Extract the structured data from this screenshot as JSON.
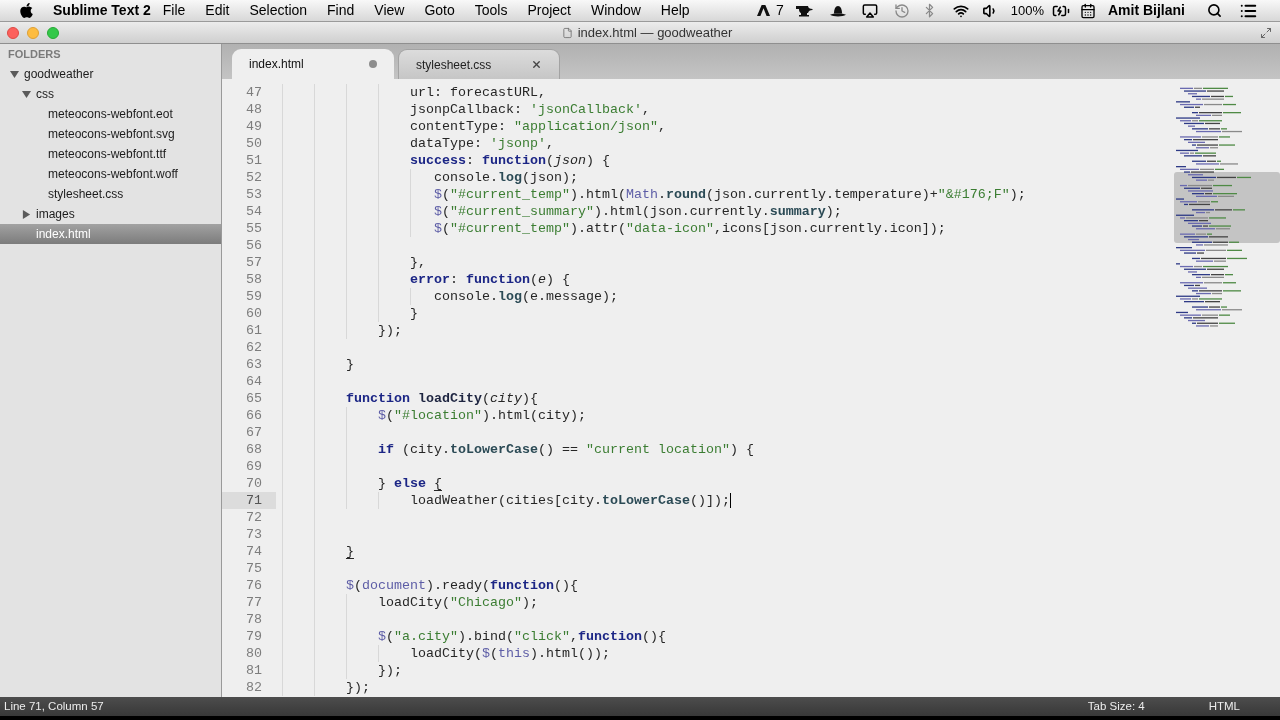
{
  "menu_bar": {
    "app_name": "Sublime Text 2",
    "menus": [
      "File",
      "Edit",
      "Selection",
      "Find",
      "View",
      "Goto",
      "Tools",
      "Project",
      "Window",
      "Help"
    ],
    "update_count": "7",
    "battery": "100%",
    "user": "Amit Bijlani"
  },
  "title_bar": {
    "title": "index.html — goodweather"
  },
  "sidebar": {
    "header": "FOLDERS",
    "items": [
      {
        "label": "goodweather",
        "kind": "folder",
        "expanded": true,
        "selected": false,
        "children": [
          {
            "label": "css",
            "kind": "folder",
            "expanded": true,
            "selected": false,
            "children": [
              {
                "label": "meteocons-webfont.eot",
                "kind": "file",
                "selected": false
              },
              {
                "label": "meteocons-webfont.svg",
                "kind": "file",
                "selected": false
              },
              {
                "label": "meteocons-webfont.ttf",
                "kind": "file",
                "selected": false
              },
              {
                "label": "meteocons-webfont.woff",
                "kind": "file",
                "selected": false
              },
              {
                "label": "stylesheet.css",
                "kind": "file",
                "selected": false
              }
            ]
          },
          {
            "label": "images",
            "kind": "folder",
            "expanded": false,
            "selected": false
          },
          {
            "label": "index.html",
            "kind": "file",
            "selected": true
          }
        ]
      }
    ]
  },
  "tabs": [
    {
      "label": "index.html",
      "selected": true,
      "modified": true
    },
    {
      "label": "stylesheet.css",
      "selected": false,
      "modified": false
    }
  ],
  "editor": {
    "lines": [
      {
        "number": "47",
        "current": false,
        "tokens": [
          {
            "text": "                url: forecastURL,",
            "kind": "plain"
          }
        ]
      },
      {
        "number": "48",
        "current": false,
        "tokens": [
          {
            "text": "                jsonpCallback: ",
            "kind": "plain"
          },
          {
            "text": "'jsonCallback'",
            "kind": "string"
          },
          {
            "text": ",",
            "kind": "plain"
          }
        ]
      },
      {
        "number": "49",
        "current": false,
        "tokens": [
          {
            "text": "                contentType: ",
            "kind": "plain"
          },
          {
            "text": "\"application/json\"",
            "kind": "string"
          },
          {
            "text": ",",
            "kind": "plain"
          }
        ]
      },
      {
        "number": "50",
        "current": false,
        "tokens": [
          {
            "text": "                dataType: ",
            "kind": "plain"
          },
          {
            "text": "'jsonp'",
            "kind": "string"
          },
          {
            "text": ",",
            "kind": "plain"
          }
        ]
      },
      {
        "number": "51",
        "current": false,
        "tokens": [
          {
            "text": "                success",
            "kind": "property"
          },
          {
            "text": ": ",
            "kind": "plain"
          },
          {
            "text": "function",
            "kind": "keyword"
          },
          {
            "text": "(",
            "kind": "plain"
          },
          {
            "text": "json",
            "kind": "param"
          },
          {
            "text": ") {",
            "kind": "plain"
          }
        ]
      },
      {
        "number": "52",
        "current": false,
        "tokens": [
          {
            "text": "                   console.",
            "kind": "plain"
          },
          {
            "text": "log",
            "kind": "method"
          },
          {
            "text": "(json);",
            "kind": "plain"
          }
        ]
      },
      {
        "number": "53",
        "current": false,
        "tokens": [
          {
            "text": "                   $",
            "kind": "builtin"
          },
          {
            "text": "(",
            "kind": "plain"
          },
          {
            "text": "\"#current_temp\"",
            "kind": "string"
          },
          {
            "text": ").html(",
            "kind": "plain"
          },
          {
            "text": "Math",
            "kind": "builtin"
          },
          {
            "text": ".",
            "kind": "plain"
          },
          {
            "text": "round",
            "kind": "method"
          },
          {
            "text": "(json.currently.temperature)+",
            "kind": "plain"
          },
          {
            "text": "\"&#176;F\"",
            "kind": "string"
          },
          {
            "text": ");",
            "kind": "plain"
          }
        ]
      },
      {
        "number": "54",
        "current": false,
        "tokens": [
          {
            "text": "                   $",
            "kind": "builtin"
          },
          {
            "text": "(",
            "kind": "plain"
          },
          {
            "text": "\"#current_summary\"",
            "kind": "string"
          },
          {
            "text": ").html(json.currently.",
            "kind": "plain"
          },
          {
            "text": "summary",
            "kind": "method"
          },
          {
            "text": ");",
            "kind": "plain"
          }
        ]
      },
      {
        "number": "55",
        "current": false,
        "tokens": [
          {
            "text": "                   $",
            "kind": "builtin"
          },
          {
            "text": "(",
            "kind": "plain"
          },
          {
            "text": "\"#current_temp\"",
            "kind": "string"
          },
          {
            "text": ").attr(",
            "kind": "plain"
          },
          {
            "text": "\"data-icon\"",
            "kind": "string"
          },
          {
            "text": ",icons[json.currently.icon]);",
            "kind": "plain"
          }
        ]
      },
      {
        "number": "56",
        "current": false
      },
      {
        "number": "57",
        "current": false,
        "tokens": [
          {
            "text": "                },",
            "kind": "plain"
          }
        ]
      },
      {
        "number": "58",
        "current": false,
        "tokens": [
          {
            "text": "                error",
            "kind": "property"
          },
          {
            "text": ": ",
            "kind": "plain"
          },
          {
            "text": "function",
            "kind": "keyword"
          },
          {
            "text": "(",
            "kind": "plain"
          },
          {
            "text": "e",
            "kind": "param"
          },
          {
            "text": ") {",
            "kind": "plain"
          }
        ]
      },
      {
        "number": "59",
        "current": false,
        "tokens": [
          {
            "text": "                   console.",
            "kind": "plain"
          },
          {
            "text": "log",
            "kind": "method"
          },
          {
            "text": "(e.message);",
            "kind": "plain"
          }
        ]
      },
      {
        "number": "60",
        "current": false,
        "tokens": [
          {
            "text": "                }",
            "kind": "plain"
          }
        ]
      },
      {
        "number": "61",
        "current": false,
        "tokens": [
          {
            "text": "            });",
            "kind": "plain"
          }
        ]
      },
      {
        "number": "62",
        "current": false
      },
      {
        "number": "63",
        "current": false,
        "tokens": [
          {
            "text": "        }",
            "kind": "plain"
          }
        ]
      },
      {
        "number": "64",
        "current": false
      },
      {
        "number": "65",
        "current": false,
        "tokens": [
          {
            "text": "        function ",
            "kind": "keyword"
          },
          {
            "text": "loadCity",
            "kind": "funcname"
          },
          {
            "text": "(",
            "kind": "plain"
          },
          {
            "text": "city",
            "kind": "param"
          },
          {
            "text": "){",
            "kind": "plain"
          }
        ]
      },
      {
        "number": "66",
        "current": false,
        "tokens": [
          {
            "text": "            $",
            "kind": "builtin"
          },
          {
            "text": "(",
            "kind": "plain"
          },
          {
            "text": "\"#location\"",
            "kind": "string"
          },
          {
            "text": ").html(city);",
            "kind": "plain"
          }
        ]
      },
      {
        "number": "67",
        "current": false
      },
      {
        "number": "68",
        "current": false,
        "tokens": [
          {
            "text": "            if",
            "kind": "keyword"
          },
          {
            "text": " (city.",
            "kind": "plain"
          },
          {
            "text": "toLowerCase",
            "kind": "method"
          },
          {
            "text": "() == ",
            "kind": "plain"
          },
          {
            "text": "\"current location\"",
            "kind": "string"
          },
          {
            "text": ") {",
            "kind": "plain"
          }
        ]
      },
      {
        "number": "69",
        "current": false
      },
      {
        "number": "70",
        "current": false,
        "tokens": [
          {
            "text": "            } ",
            "kind": "plain"
          },
          {
            "text": "else ",
            "kind": "keyword"
          },
          {
            "text": "{",
            "kind": "bracket"
          }
        ]
      },
      {
        "number": "71",
        "current": true,
        "tokens": [
          {
            "text": "                loadWeather(cities[city.",
            "kind": "plain"
          },
          {
            "text": "toLowerCase",
            "kind": "method"
          },
          {
            "text": "()]);",
            "kind": "plain"
          }
        ]
      },
      {
        "number": "72",
        "current": false
      },
      {
        "number": "73",
        "current": false
      },
      {
        "number": "74",
        "current": false,
        "tokens": [
          {
            "text": "        }",
            "kind": "bracket"
          }
        ]
      },
      {
        "number": "75",
        "current": false
      },
      {
        "number": "76",
        "current": false,
        "tokens": [
          {
            "text": "        $",
            "kind": "builtin"
          },
          {
            "text": "(",
            "kind": "plain"
          },
          {
            "text": "document",
            "kind": "builtin"
          },
          {
            "text": ").ready(",
            "kind": "plain"
          },
          {
            "text": "function",
            "kind": "keyword"
          },
          {
            "text": "(){",
            "kind": "plain"
          }
        ]
      },
      {
        "number": "77",
        "current": false,
        "tokens": [
          {
            "text": "            loadCity(",
            "kind": "plain"
          },
          {
            "text": "\"Chicago\"",
            "kind": "string"
          },
          {
            "text": ");",
            "kind": "plain"
          }
        ]
      },
      {
        "number": "78",
        "current": false
      },
      {
        "number": "79",
        "current": false,
        "tokens": [
          {
            "text": "            $",
            "kind": "builtin"
          },
          {
            "text": "(",
            "kind": "plain"
          },
          {
            "text": "\"a.city\"",
            "kind": "string"
          },
          {
            "text": ").bind(",
            "kind": "plain"
          },
          {
            "text": "\"click\"",
            "kind": "string"
          },
          {
            "text": ",",
            "kind": "plain"
          },
          {
            "text": "function",
            "kind": "keyword"
          },
          {
            "text": "(){",
            "kind": "plain"
          }
        ]
      },
      {
        "number": "80",
        "current": false,
        "tokens": [
          {
            "text": "                loadCity(",
            "kind": "plain"
          },
          {
            "text": "$",
            "kind": "builtin"
          },
          {
            "text": "(",
            "kind": "plain"
          },
          {
            "text": "this",
            "kind": "builtin"
          },
          {
            "text": ").html());",
            "kind": "plain"
          }
        ]
      },
      {
        "number": "81",
        "current": false,
        "tokens": [
          {
            "text": "            });",
            "kind": "plain"
          }
        ]
      },
      {
        "number": "82",
        "current": false,
        "tokens": [
          {
            "text": "        });",
            "kind": "plain"
          }
        ]
      }
    ]
  },
  "status_bar": {
    "position": "Line 71, Column 57",
    "tab_size": "Tab Size: 4",
    "syntax": "HTML"
  }
}
